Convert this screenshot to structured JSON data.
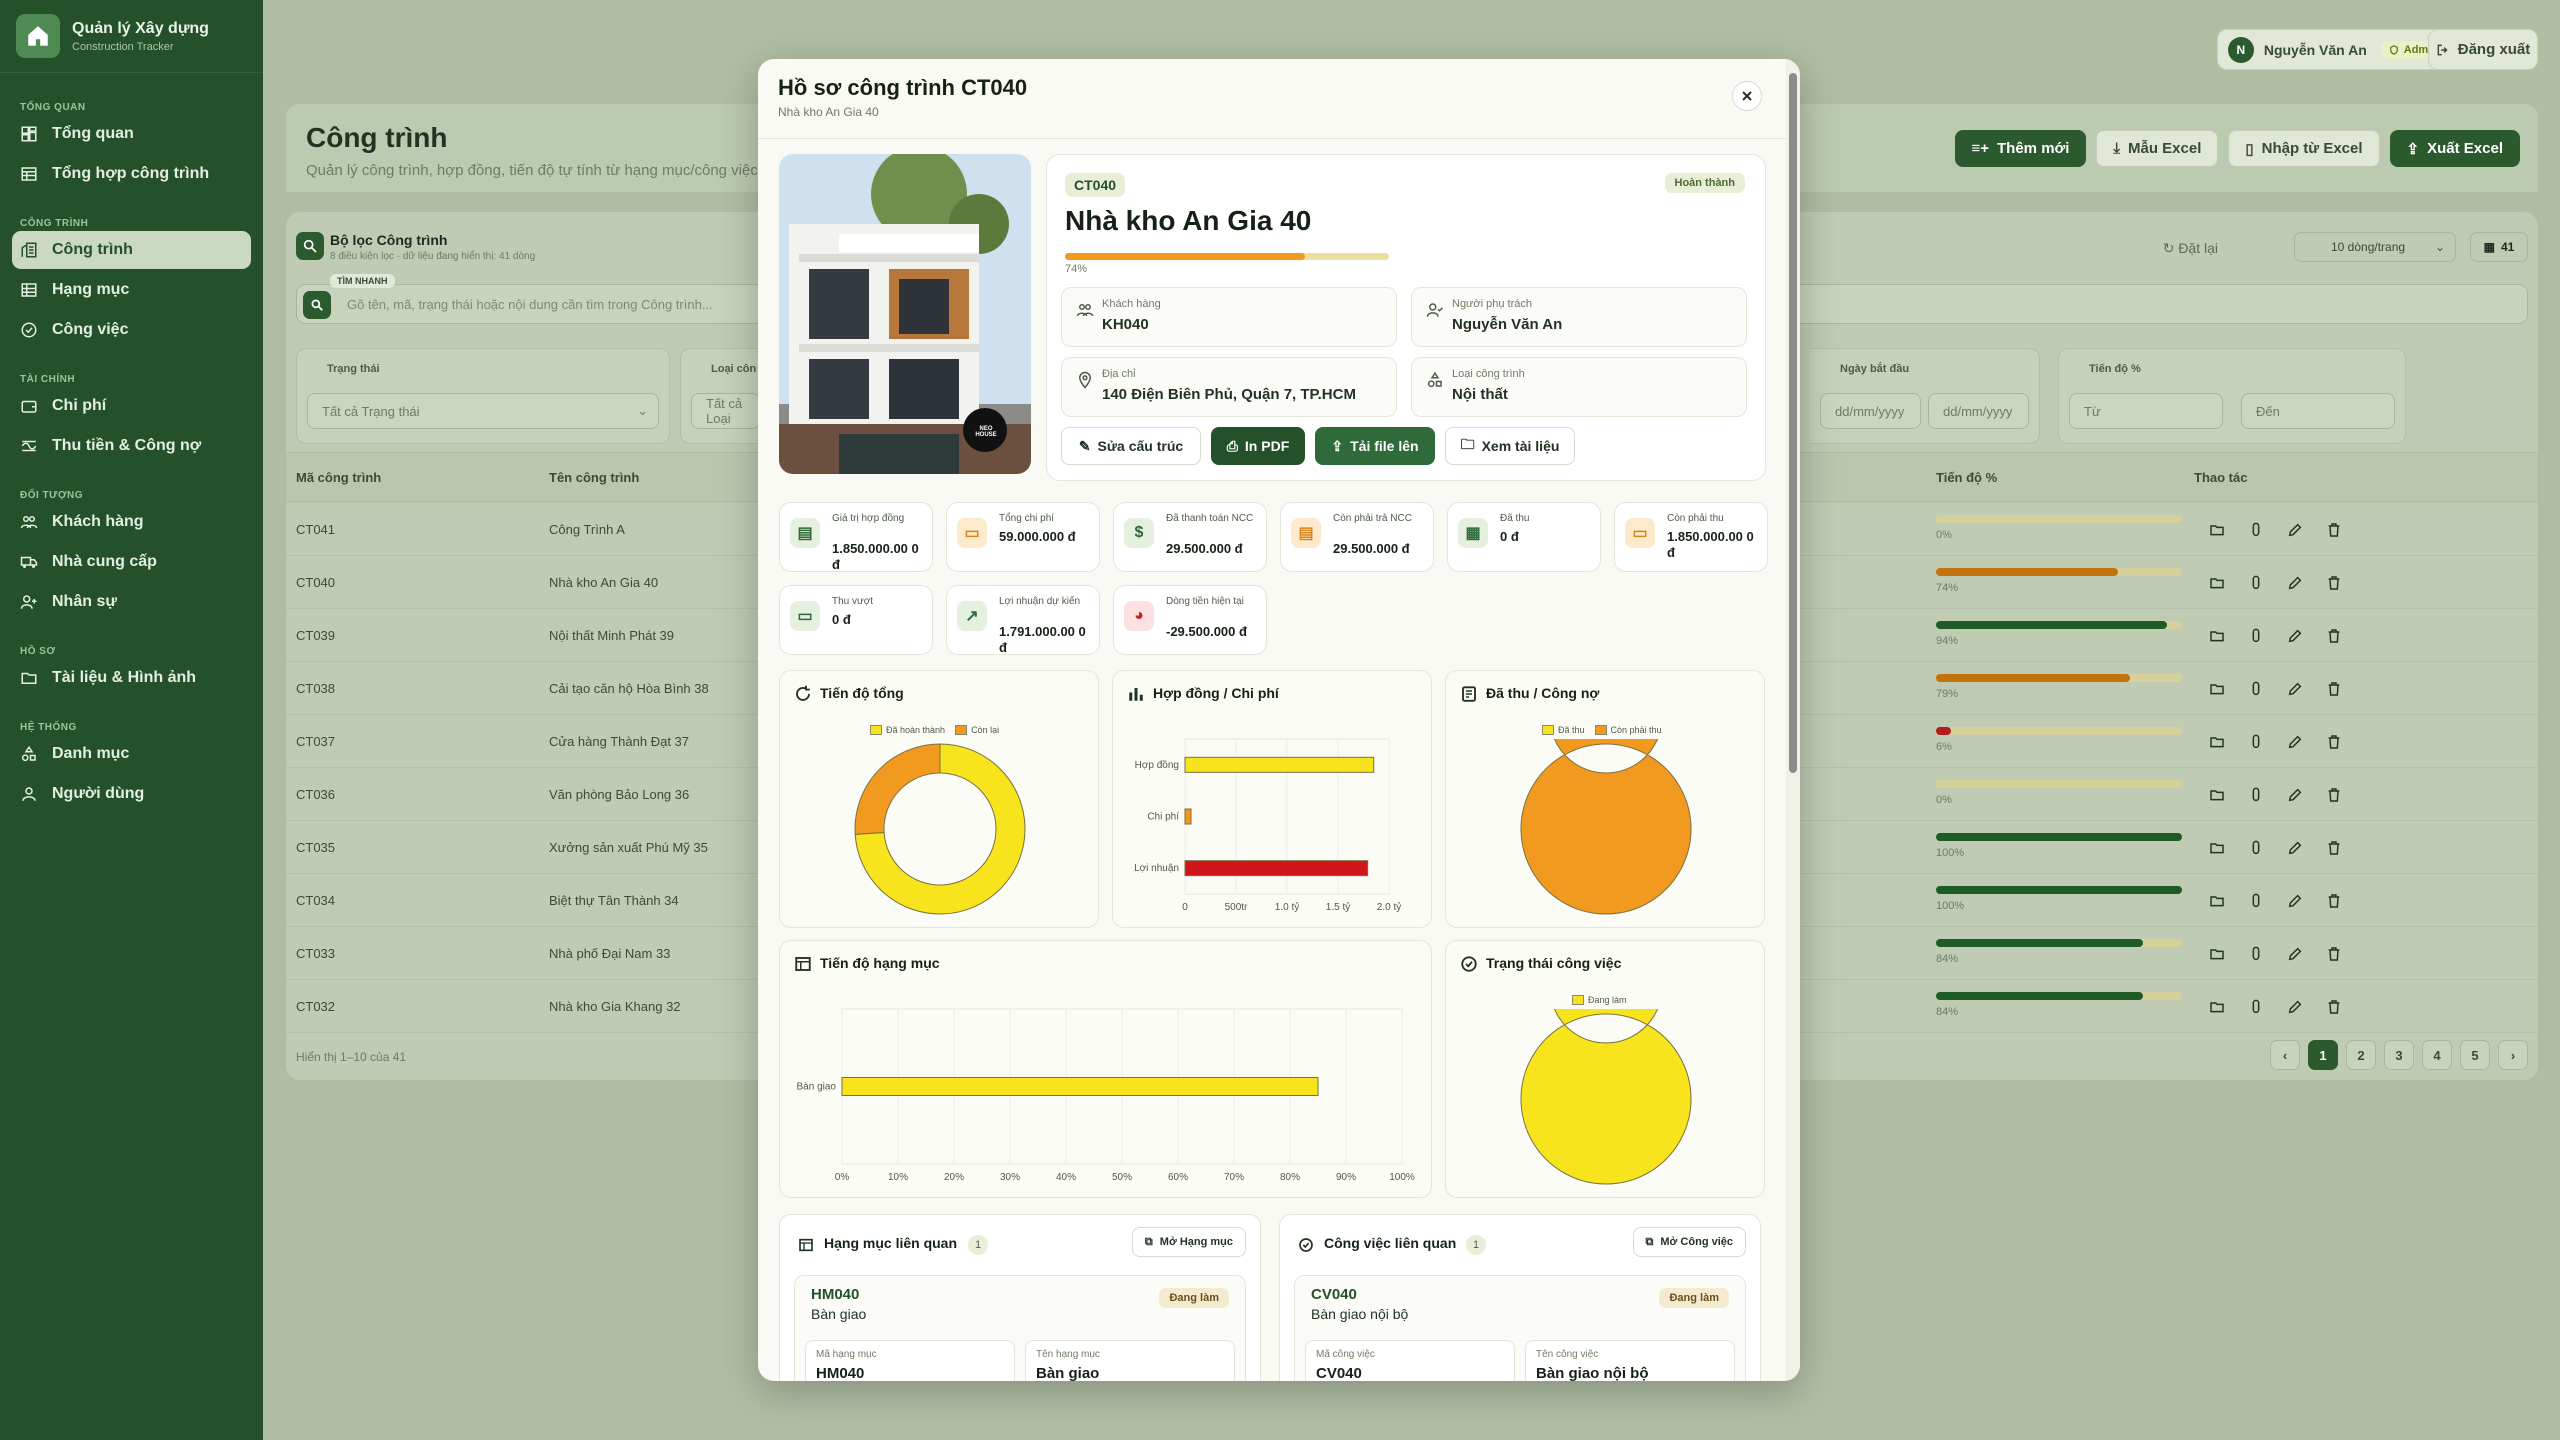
{
  "brand": {
    "title": "Quản lý Xây dựng",
    "subtitle": "Construction Tracker"
  },
  "nav": [
    {
      "section": "TỔNG QUAN",
      "items": [
        {
          "label": "Tổng quan",
          "icon": "dashboard-icon"
        },
        {
          "label": "Tổng hợp công trình",
          "icon": "table-icon"
        }
      ]
    },
    {
      "section": "CÔNG TRÌNH",
      "items": [
        {
          "label": "Công trình",
          "icon": "building-icon",
          "active": true
        },
        {
          "label": "Hạng mục",
          "icon": "list-icon"
        },
        {
          "label": "Công việc",
          "icon": "check-circle-icon"
        }
      ]
    },
    {
      "section": "TÀI CHÍNH",
      "items": [
        {
          "label": "Chi phí",
          "icon": "wallet-icon"
        },
        {
          "label": "Thu tiền & Công nợ",
          "icon": "money-icon"
        }
      ]
    },
    {
      "section": "ĐỐI TƯỢNG",
      "items": [
        {
          "label": "Khách hàng",
          "icon": "users-icon"
        },
        {
          "label": "Nhà cung cấp",
          "icon": "truck-icon"
        },
        {
          "label": "Nhân sự",
          "icon": "user-plus-icon"
        }
      ]
    },
    {
      "section": "HỒ SƠ",
      "items": [
        {
          "label": "Tài liệu & Hình ảnh",
          "icon": "folder-icon"
        }
      ]
    },
    {
      "section": "HỆ THỐNG",
      "items": [
        {
          "label": "Danh mục",
          "icon": "category-icon"
        },
        {
          "label": "Người dùng",
          "icon": "user-icon"
        }
      ]
    }
  ],
  "user": {
    "initial": "N",
    "name": "Nguyễn Văn An",
    "role": "Admin",
    "logout": "Đăng xuất"
  },
  "page": {
    "title": "Công trình",
    "subtitle": "Quản lý công trình, hợp đồng, tiến độ tự tính từ hạng mục/công việc",
    "buttons": [
      "Thêm mới",
      "Mẫu Excel",
      "Nhập từ Excel",
      "Xuất Excel"
    ]
  },
  "filter": {
    "title": "Bộ lọc Công trình",
    "subtitle": "8 điều kiện lọc · dữ liệu đang hiển thị: 41 dòng",
    "quick_tag": "TÌM NHANH",
    "search_placeholder": "Gõ tên, mã, trạng thái hoặc nội dung cần tìm trong Công trình...",
    "reset": "Đặt lại",
    "per_page": "10 dòng/trang",
    "count": "41",
    "status_label": "Trạng thái",
    "status_value": "Tất cả Trạng thái",
    "type_label": "Loại côn",
    "type_value": "Tất cả Loại",
    "start_label": "Ngày bắt đầu",
    "date_ph": "dd/mm/yyyy",
    "progress_label": "Tiến độ %",
    "from_ph": "Từ",
    "to_ph": "Đến"
  },
  "table": {
    "headers": [
      "Mã công trình",
      "Tên công trình",
      "Tiến độ %",
      "Thao tác"
    ],
    "rows": [
      {
        "code": "CT041",
        "name": "Công Trình A",
        "progress": 0,
        "label": "0%",
        "color": "#d4d29a"
      },
      {
        "code": "CT040",
        "name": "Nhà kho An Gia 40",
        "progress": 74,
        "label": "74%",
        "color": "#c2730d"
      },
      {
        "code": "CT039",
        "name": "Nội thất Minh Phát 39",
        "progress": 94,
        "label": "94%",
        "color": "#1f5b26"
      },
      {
        "code": "CT038",
        "name": "Cải tạo căn hộ Hòa Bình 38",
        "progress": 79,
        "label": "79%",
        "color": "#c2730d"
      },
      {
        "code": "CT037",
        "name": "Cửa hàng Thành Đạt 37",
        "progress": 6,
        "label": "6%",
        "color": "#b51d1d"
      },
      {
        "code": "CT036",
        "name": "Văn phòng Bảo Long 36",
        "progress": 0,
        "label": "0%",
        "color": "#d4d29a"
      },
      {
        "code": "CT035",
        "name": "Xưởng sản xuất Phú Mỹ 35",
        "progress": 100,
        "label": "100%",
        "color": "#1f5b26"
      },
      {
        "code": "CT034",
        "name": "Biệt thự Tân Thành 34",
        "progress": 100,
        "label": "100%",
        "color": "#1f5b26"
      },
      {
        "code": "CT033",
        "name": "Nhà phố Đại Nam 33",
        "progress": 84,
        "label": "84%",
        "color": "#1f5b26"
      },
      {
        "code": "CT032",
        "name": "Nhà kho Gia Khang 32",
        "progress": 84,
        "label": "84%",
        "color": "#1f5b26"
      }
    ],
    "showing": "Hiển thị 1–10 của 41",
    "pages": [
      "‹",
      "1",
      "2",
      "3",
      "4",
      "5",
      "›"
    ]
  },
  "modal": {
    "title": "Hồ sơ công trình CT040",
    "subtitle": "Nhà kho An Gia 40",
    "code": "CT040",
    "status": "Hoàn thành",
    "name": "Nhà kho An Gia 40",
    "progress": 74,
    "progress_label": "74%",
    "image_logo": "NEO HOUSE",
    "info": [
      {
        "label": "Khách hàng",
        "value": "KH040",
        "icon": "users-icon"
      },
      {
        "label": "Người phụ trách",
        "value": "Nguyễn Văn An",
        "icon": "user-check-icon"
      },
      {
        "label": "Địa chỉ",
        "value": "140 Điện Biên Phủ, Quận 7, TP.HCM",
        "icon": "map-pin-icon"
      },
      {
        "label": "Loại công trình",
        "value": "Nội thất",
        "icon": "category-icon"
      }
    ],
    "actions": [
      "Sửa cấu trúc",
      "In PDF",
      "Tải file lên",
      "Xem tài liệu"
    ],
    "stats": [
      {
        "label": "Giá trị hợp đồng",
        "value": "1.850.000.00 0 đ",
        "bg": "#e6f0de",
        "fg": "#2f6a3a"
      },
      {
        "label": "Tổng chi phí",
        "value": "59.000.000 đ",
        "bg": "#fdeacd",
        "fg": "#d8861a"
      },
      {
        "label": "Đã thanh toán NCC",
        "value": "29.500.000 đ",
        "bg": "#e6f0de",
        "fg": "#2f6a3a"
      },
      {
        "label": "Còn phải trả NCC",
        "value": "29.500.000 đ",
        "bg": "#fdeacd",
        "fg": "#d8861a"
      },
      {
        "label": "Đã thu",
        "value": "0 đ",
        "bg": "#e6f0de",
        "fg": "#2f6a3a"
      },
      {
        "label": "Còn phải thu",
        "value": "1.850.000.00 0 đ",
        "bg": "#fdeacd",
        "fg": "#d8861a"
      },
      {
        "label": "Thu vượt",
        "value": "0 đ",
        "bg": "#e6f0de",
        "fg": "#2f6a3a"
      },
      {
        "label": "Lợi nhuận dự kiến",
        "value": "1.791.000.00 0 đ",
        "bg": "#e6f0de",
        "fg": "#2f6a3a"
      },
      {
        "label": "Dòng tiền hiện tại",
        "value": "-29.500.000 đ",
        "bg": "#fbe1e1",
        "fg": "#c0272d"
      }
    ],
    "related": [
      {
        "title": "Hạng mục liên quan",
        "count": "1",
        "button": "Mở Hạng mục",
        "code": "HM040",
        "name": "Bàn giao",
        "status": "Đang làm",
        "f1_label": "Mã hạng mục",
        "f1_value": "HM040",
        "f2_label": "Tên hạng mục",
        "f2_value": "Bàn giao"
      },
      {
        "title": "Công việc liên quan",
        "count": "1",
        "button": "Mở Công việc",
        "code": "CV040",
        "name": "Bàn giao nội bộ",
        "status": "Đang làm",
        "f1_label": "Mã công việc",
        "f1_value": "CV040",
        "f2_label": "Tên công việc",
        "f2_value": "Bàn giao nội bộ"
      }
    ]
  },
  "chart_data": [
    {
      "type": "pie",
      "title": "Tiến độ tổng",
      "labels": [
        "Đã hoàn thành",
        "Còn lại"
      ],
      "values": [
        74,
        26
      ],
      "colors": [
        "#f7e41d",
        "#f29a1f"
      ],
      "legend": "top"
    },
    {
      "type": "bar",
      "orientation": "horizontal",
      "title": "Hợp đồng / Chi phí",
      "categories": [
        "Hợp đồng",
        "Chi phí",
        "Lợi nhuận"
      ],
      "values": [
        1850000000,
        59000000,
        1791000000
      ],
      "colors": [
        "#f7e41d",
        "#f29a1f",
        "#d0141c"
      ],
      "xlim": [
        0,
        2000000000
      ],
      "ticks": [
        "0",
        "500tr",
        "1.0 tỷ",
        "1.5 tỷ",
        "2.0 tỷ"
      ]
    },
    {
      "type": "pie",
      "title": "Đã thu / Công nợ",
      "labels": [
        "Đã thu",
        "Còn phải thu"
      ],
      "values": [
        0,
        1850000000
      ],
      "colors": [
        "#f7e41d",
        "#f29a1f"
      ],
      "legend": "top"
    },
    {
      "type": "bar",
      "orientation": "horizontal",
      "title": "Tiến độ hạng mục",
      "categories": [
        "Bàn giao"
      ],
      "values": [
        85
      ],
      "colors": [
        "#f7e41d"
      ],
      "xlim": [
        0,
        100
      ],
      "ticks": [
        "0%",
        "10%",
        "20%",
        "30%",
        "40%",
        "50%",
        "60%",
        "70%",
        "80%",
        "90%",
        "100%"
      ]
    },
    {
      "type": "pie",
      "title": "Trạng thái công việc",
      "labels": [
        "Đang làm"
      ],
      "values": [
        1
      ],
      "colors": [
        "#f7e41d"
      ],
      "legend": "top"
    }
  ]
}
